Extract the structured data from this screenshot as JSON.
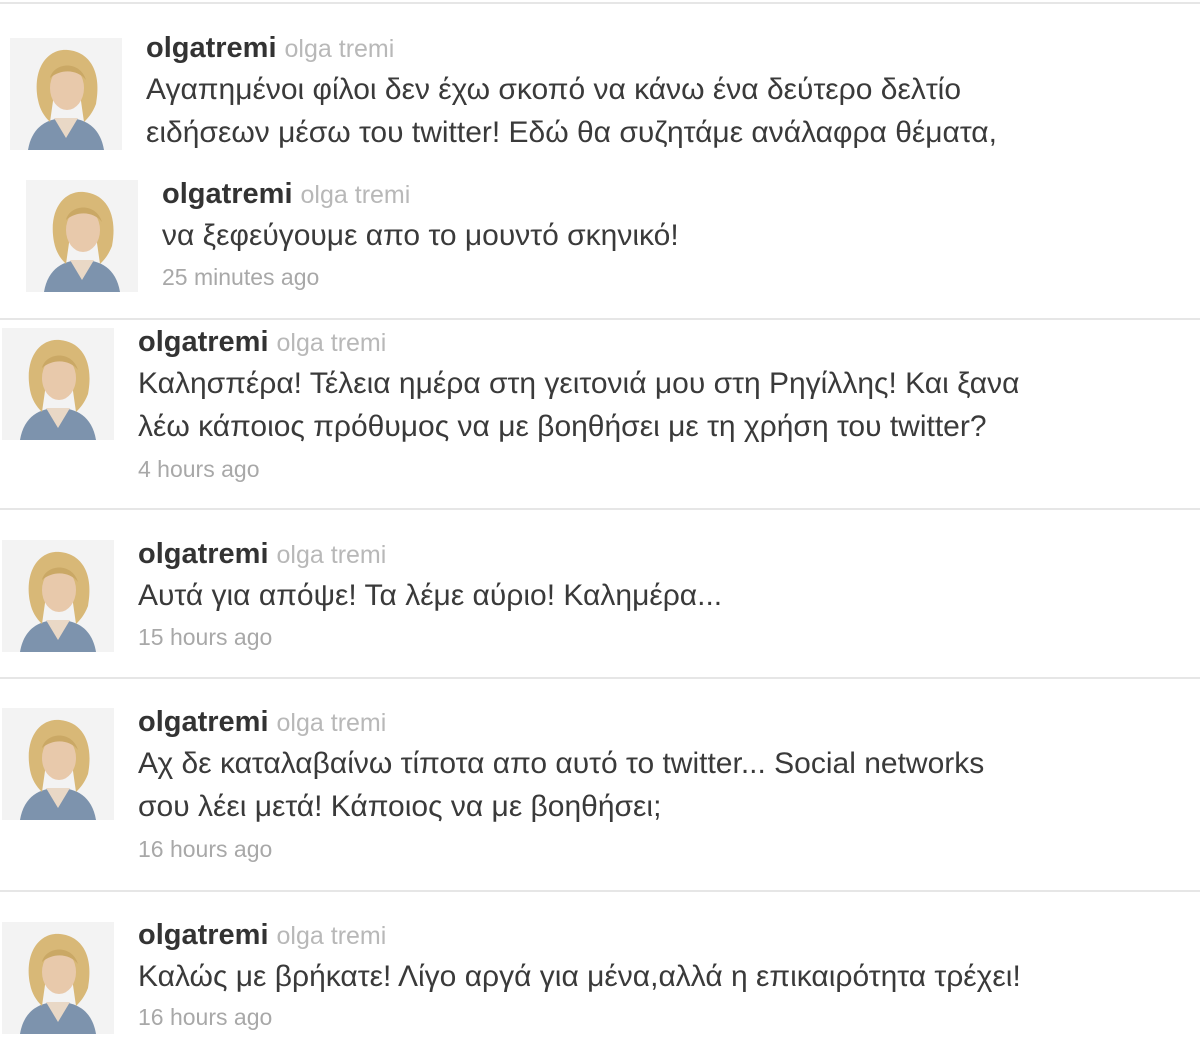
{
  "accent_colors": {
    "username": "#333333",
    "fullname": "#b8b8b8",
    "timestamp": "#a8a8a8",
    "divider": "#e6e6e6"
  },
  "tweets": [
    {
      "username": "olgatremi",
      "fullname": "olga tremi",
      "text": "Αγαπημένοι φίλοι δεν έχω σκοπό να κάνω ένα δεύτερο δελτίο\nειδήσεων μέσω του twitter! Εδώ θα συζητάμε ανάλαφρα θέματα,",
      "time": "",
      "avatar_icon": "profile-photo"
    },
    {
      "username": "olgatremi",
      "fullname": "olga tremi",
      "text": "να ξεφεύγουμε απο το μουντό σκηνικό!",
      "time": "25 minutes ago",
      "avatar_icon": "profile-photo"
    },
    {
      "username": "olgatremi",
      "fullname": "olga tremi",
      "text": "Καλησπέρα! Τέλεια ημέρα στη γειτονιά μου στη Ρηγίλλης! Και ξανα\nλέω κάποιος πρόθυμος να με βοηθήσει με τη χρήση του twitter?",
      "time": "4 hours ago",
      "avatar_icon": "profile-photo"
    },
    {
      "username": "olgatremi",
      "fullname": "olga tremi",
      "text": "Αυτά για απόψε! Τα λέμε αύριο! Καλημέρα...",
      "time": "15 hours ago",
      "avatar_icon": "profile-photo"
    },
    {
      "username": "olgatremi",
      "fullname": "olga tremi",
      "text": "Αχ δε καταλαβαίνω τίποτα απο αυτό το twitter... Social networks\nσου λέει μετά! Κάποιος να με βοηθήσει;",
      "time": "16 hours ago",
      "avatar_icon": "profile-photo"
    },
    {
      "username": "olgatremi",
      "fullname": "olga tremi",
      "text": "Καλώς με βρήκατε! Λίγο αργά για μένα,αλλά η επικαιρότητα τρέχει!",
      "time": "16 hours ago",
      "avatar_icon": "profile-photo"
    }
  ]
}
